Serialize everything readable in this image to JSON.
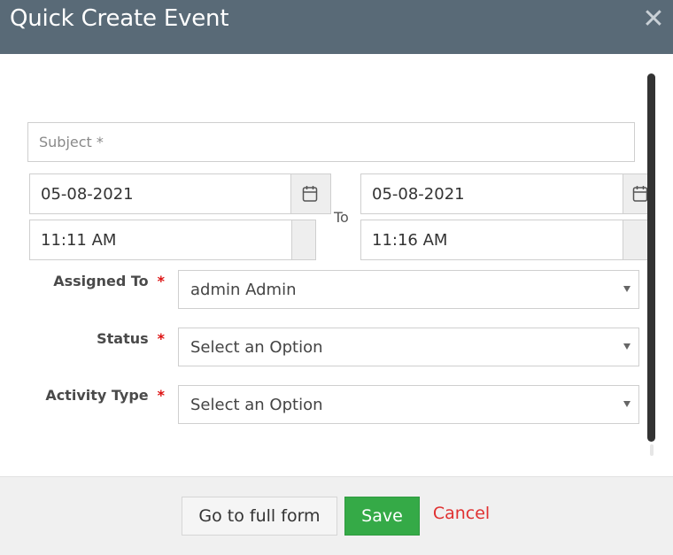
{
  "modal": {
    "title": "Quick Create Event",
    "close_icon": "close-icon"
  },
  "form": {
    "subject": {
      "placeholder": "Subject *",
      "value": ""
    },
    "start_date": "05-08-2021",
    "start_time": "11:11 AM",
    "to_label": "To",
    "end_date": "05-08-2021",
    "end_time": "11:16 AM",
    "assigned_to": {
      "label": "Assigned To",
      "required": "*",
      "value": "admin Admin"
    },
    "status": {
      "label": "Status",
      "required": "*",
      "value": "Select an Option"
    },
    "activity_type": {
      "label": "Activity Type",
      "required": "*",
      "value": "Select an Option"
    }
  },
  "footer": {
    "full_form_label": "Go to full form",
    "save_label": "Save",
    "cancel_label": "Cancel"
  },
  "colors": {
    "header_bg": "#596a77",
    "save_bg": "#35aa47",
    "cancel_text": "#e03030",
    "required": "#dd1111"
  }
}
